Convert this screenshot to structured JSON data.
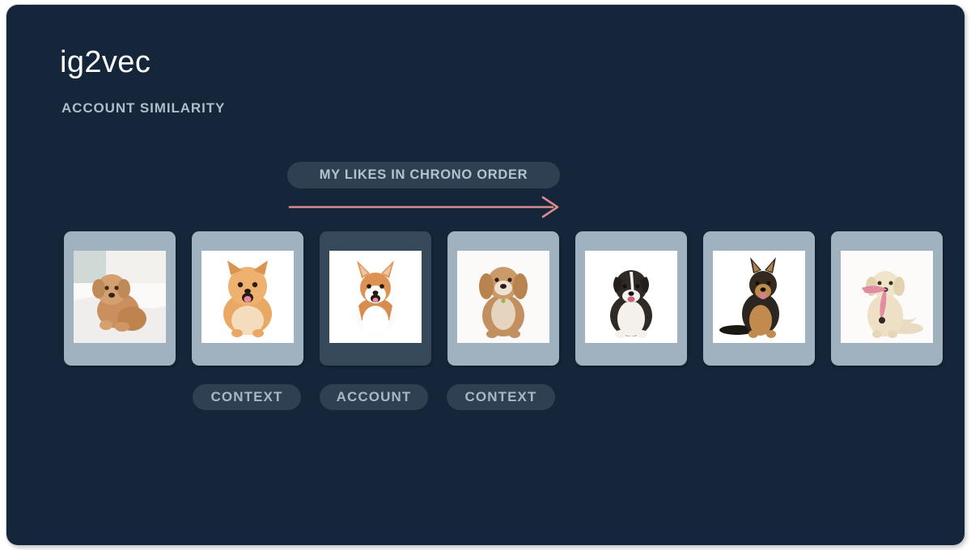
{
  "theme": {
    "canvas_bg": "#16263a",
    "card_frame": "#a0b1bf",
    "card_frame_account": "#36495a",
    "pill_bg": "#2e4052",
    "pill_text": "#aebdcb",
    "arrow_color": "#d98b8b",
    "title_color": "#fdfdfd"
  },
  "header": {
    "title": "ig2vec",
    "subtitle": "ACCOUNT SIMILARITY"
  },
  "chrono": {
    "banner_label": "MY LIKES IN CHRONO ORDER",
    "arrow_direction": "right"
  },
  "cards": [
    {
      "index": 1,
      "role": "",
      "photo": "toy-poodle-puppy-on-white-bedding",
      "highlighted": false
    },
    {
      "index": 2,
      "role": "CONTEXT",
      "photo": "pomeranian-smiling-on-white",
      "highlighted": false
    },
    {
      "index": 3,
      "role": "ACCOUNT",
      "photo": "corgi-sitting-on-white",
      "highlighted": true
    },
    {
      "index": 4,
      "role": "CONTEXT",
      "photo": "cockapoo-sitting-on-white",
      "highlighted": false
    },
    {
      "index": 5,
      "role": "",
      "photo": "australian-shepherd-puppy-on-white",
      "highlighted": false
    },
    {
      "index": 6,
      "role": "",
      "photo": "german-shepherd-puppy-on-white",
      "highlighted": false
    },
    {
      "index": 7,
      "role": "",
      "photo": "golden-retriever-with-pink-leash",
      "highlighted": false
    }
  ],
  "role_pills": [
    {
      "label": "CONTEXT",
      "for_card": 2
    },
    {
      "label": "ACCOUNT",
      "for_card": 3
    },
    {
      "label": "CONTEXT",
      "for_card": 4
    }
  ]
}
